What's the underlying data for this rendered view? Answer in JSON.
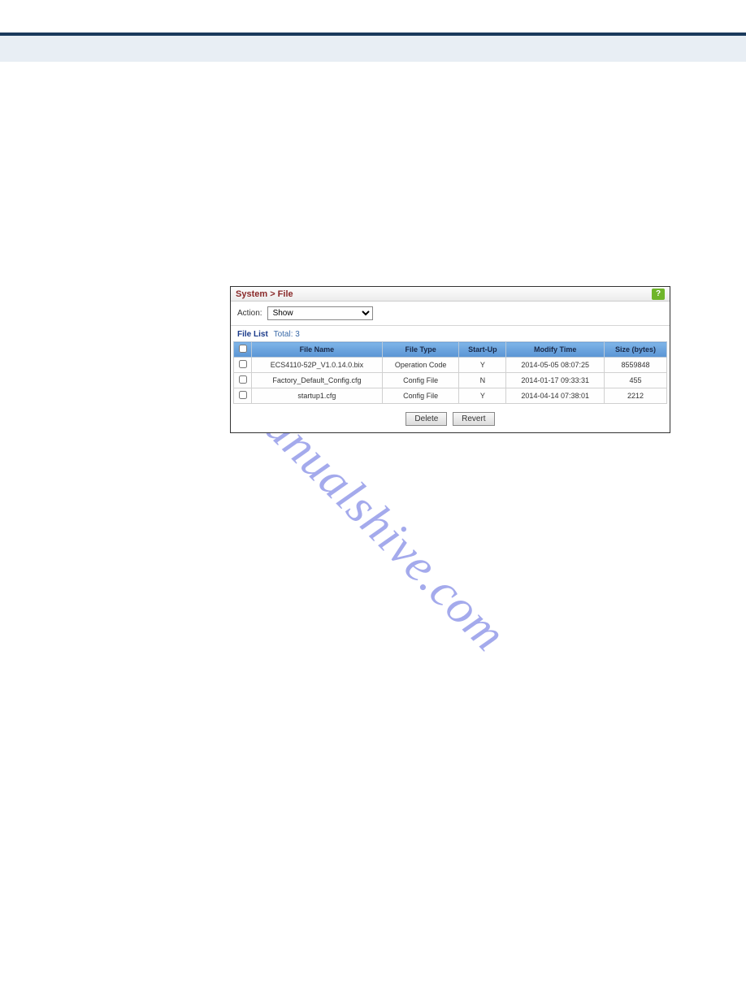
{
  "watermark": "manualshive.com",
  "breadcrumb": "System > File",
  "help_icon": "?",
  "action": {
    "label": "Action:",
    "selected": "Show"
  },
  "file_list": {
    "title": "File List",
    "total_label": "Total: 3"
  },
  "table": {
    "headers": {
      "checkbox": "",
      "file_name": "File Name",
      "file_type": "File Type",
      "start_up": "Start-Up",
      "modify_time": "Modify Time",
      "size": "Size (bytes)"
    },
    "rows": [
      {
        "file_name": "ECS4110-52P_V1.0.14.0.bix",
        "file_type": "Operation Code",
        "start_up": "Y",
        "modify_time": "2014-05-05 08:07:25",
        "size": "8559848"
      },
      {
        "file_name": "Factory_Default_Config.cfg",
        "file_type": "Config File",
        "start_up": "N",
        "modify_time": "2014-01-17 09:33:31",
        "size": "455"
      },
      {
        "file_name": "startup1.cfg",
        "file_type": "Config File",
        "start_up": "Y",
        "modify_time": "2014-04-14 07:38:01",
        "size": "2212"
      }
    ]
  },
  "buttons": {
    "delete": "Delete",
    "revert": "Revert"
  }
}
